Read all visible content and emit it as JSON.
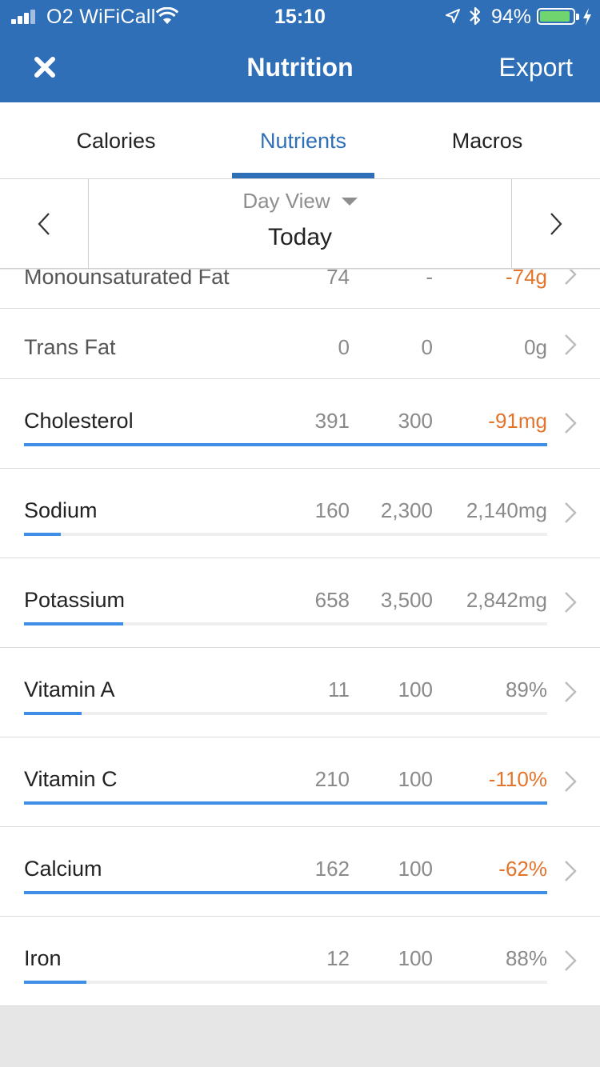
{
  "status": {
    "carrier": "O2 WiFiCall",
    "time": "15:10",
    "battery_pct": "94%",
    "battery_level": 0.94
  },
  "header": {
    "close_icon": "close-x-icon",
    "title": "Nutrition",
    "export_label": "Export"
  },
  "tabs": [
    {
      "label": "Calories",
      "active": false
    },
    {
      "label": "Nutrients",
      "active": true
    },
    {
      "label": "Macros",
      "active": false
    }
  ],
  "datenav": {
    "view_label": "Day View",
    "date_label": "Today"
  },
  "nutrients": [
    {
      "name": "Monounsaturated Fat",
      "total": "74",
      "goal": "-",
      "left": "-74g",
      "over": true,
      "progress": null
    },
    {
      "name": "Trans Fat",
      "total": "0",
      "goal": "0",
      "left": "0g",
      "over": false,
      "progress": null
    },
    {
      "name": "Cholesterol",
      "total": "391",
      "goal": "300",
      "left": "-91mg",
      "over": true,
      "progress": 1.0
    },
    {
      "name": "Sodium",
      "total": "160",
      "goal": "2,300",
      "left": "2,140mg",
      "over": false,
      "progress": 0.07
    },
    {
      "name": "Potassium",
      "total": "658",
      "goal": "3,500",
      "left": "2,842mg",
      "over": false,
      "progress": 0.19
    },
    {
      "name": "Vitamin A",
      "total": "11",
      "goal": "100",
      "left": "89%",
      "over": false,
      "progress": 0.11
    },
    {
      "name": "Vitamin C",
      "total": "210",
      "goal": "100",
      "left": "-110%",
      "over": true,
      "progress": 1.0
    },
    {
      "name": "Calcium",
      "total": "162",
      "goal": "100",
      "left": "-62%",
      "over": true,
      "progress": 1.0
    },
    {
      "name": "Iron",
      "total": "12",
      "goal": "100",
      "left": "88%",
      "over": false,
      "progress": 0.12
    }
  ],
  "colors": {
    "brand": "#2f6fb8",
    "progress": "#3d8ee4",
    "over": "#e2742c"
  }
}
